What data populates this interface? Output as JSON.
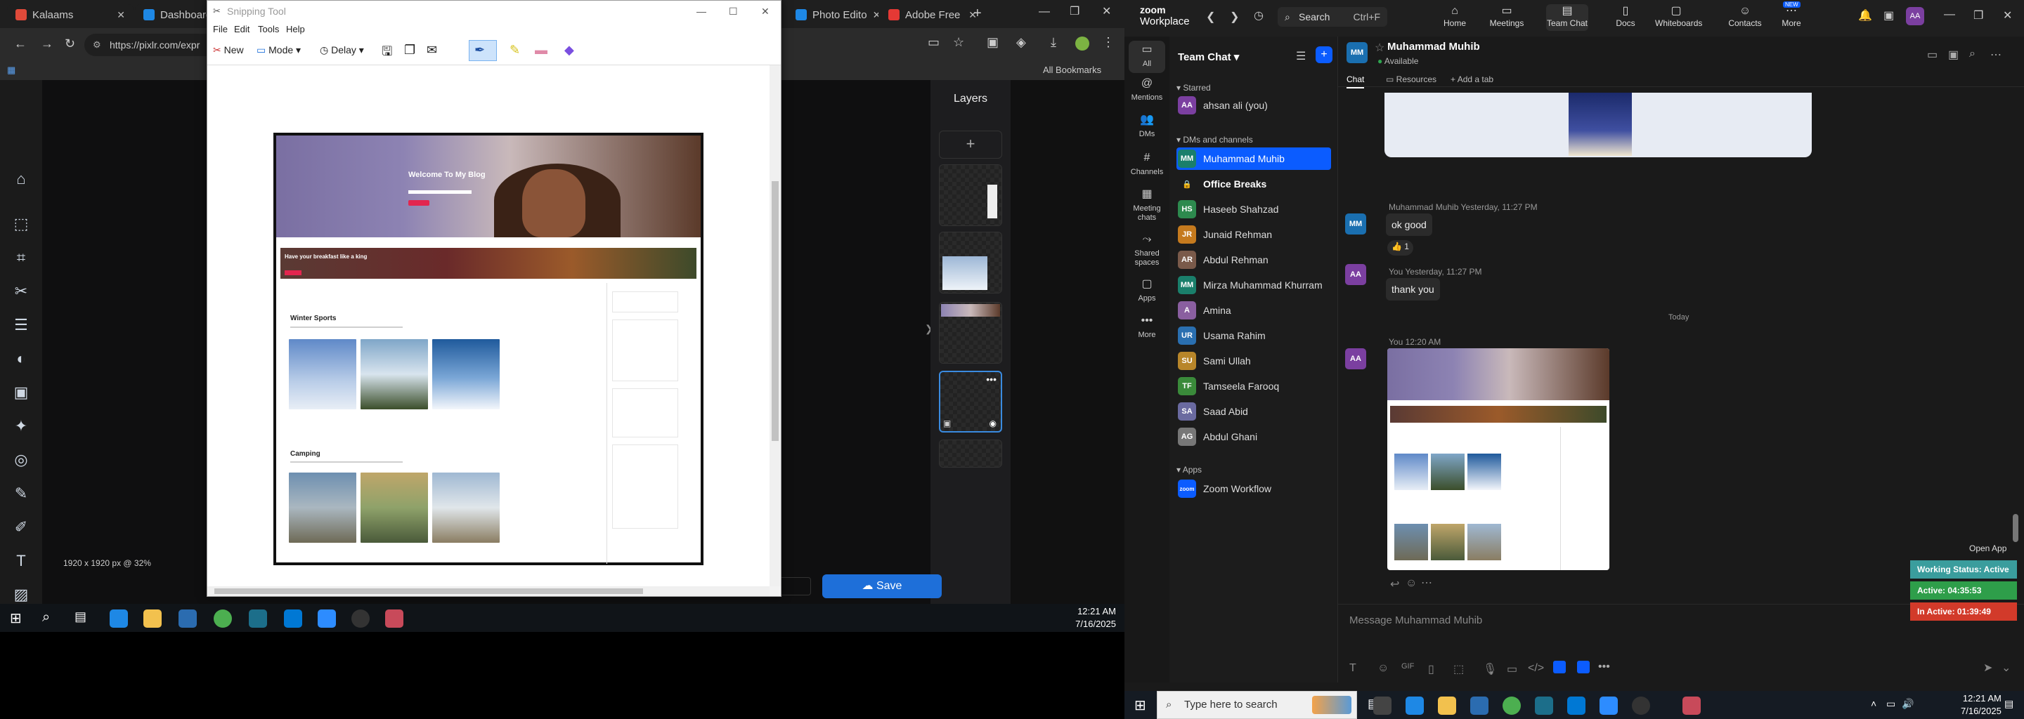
{
  "left_screen": {
    "browser_tabs": [
      {
        "title": "Kalaams",
        "color": "#e04a3a"
      },
      {
        "title": "Dashboard",
        "color": "#1e88e5"
      },
      {
        "title": "Photo Edito",
        "color": "#1e88e5"
      },
      {
        "title": "Adobe Free",
        "color": "#e53935"
      }
    ],
    "url": "https://pixlr.com/expr",
    "bookmarks_label": "All Bookmarks",
    "pixlr": {
      "layers_title": "Layers",
      "zoom_info": "1920 x 1920 px @ 32%",
      "save_label": "Save"
    },
    "snipping_tool": {
      "title": "Snipping Tool",
      "menu": [
        "File",
        "Edit",
        "Tools",
        "Help"
      ],
      "toolbar": {
        "new": "New",
        "mode": "Mode",
        "delay": "Delay"
      }
    },
    "blog": {
      "hero_title": "Welcome To My Blog",
      "breakfast_title": "Have your breakfast like a king",
      "section1": "Winter Sports",
      "section2": "Camping"
    },
    "clock": {
      "time": "12:21 AM",
      "date": "7/16/2025"
    }
  },
  "zoom": {
    "brand": "zoom",
    "brand_sub": "Workplace",
    "search_label": "Search",
    "search_shortcut": "Ctrl+F",
    "nav": [
      {
        "label": "Home",
        "icon": "home-icon"
      },
      {
        "label": "Meetings",
        "icon": "camera-icon"
      },
      {
        "label": "Team Chat",
        "icon": "chat-icon"
      },
      {
        "label": "Docs",
        "icon": "doc-icon"
      },
      {
        "label": "Whiteboards",
        "icon": "whiteboard-icon"
      },
      {
        "label": "Contacts",
        "icon": "contacts-icon"
      },
      {
        "label": "More",
        "icon": "more-icon",
        "badge": "NEW"
      }
    ],
    "rail": [
      {
        "label": "All"
      },
      {
        "label": "Mentions"
      },
      {
        "label": "DMs"
      },
      {
        "label": "Channels"
      },
      {
        "label": "Meeting chats"
      },
      {
        "label": "Shared spaces"
      },
      {
        "label": "Apps"
      },
      {
        "label": "More"
      }
    ],
    "list_title": "Team Chat",
    "starred_label": "Starred",
    "starred": [
      {
        "name": "ahsan ali (you)",
        "initials": "AA",
        "color": "#7b3fa0"
      }
    ],
    "dms_label": "DMs and channels",
    "dms": [
      {
        "name": "Muhammad Muhib",
        "initials": "MM",
        "color": "#1a7f6b"
      },
      {
        "name": "Office Breaks",
        "initials": "",
        "color": "#666"
      },
      {
        "name": "Haseeb Shahzad",
        "initials": "HS",
        "color": "#2d8a4e"
      },
      {
        "name": "Junaid Rehman",
        "initials": "JR",
        "color": "#c57a1e"
      },
      {
        "name": "Abdul Rehman",
        "initials": "AR",
        "color": "#7a5a4a"
      },
      {
        "name": "Mirza Muhammad Khurram",
        "initials": "MM",
        "color": "#1a7f6b"
      },
      {
        "name": "Amina",
        "initials": "A",
        "color": "#8a5fa0"
      },
      {
        "name": "Usama Rahim",
        "initials": "UR",
        "color": "#2a6fb0"
      },
      {
        "name": "Sami Ullah",
        "initials": "SU",
        "color": "#b8862a"
      },
      {
        "name": "Tamseela Farooq",
        "initials": "TF",
        "color": "#3a8a3a"
      },
      {
        "name": "Saad Abid",
        "initials": "SA",
        "color": "#6a6aa0"
      },
      {
        "name": "Abdul Ghani",
        "initials": "AG",
        "color": "#777"
      }
    ],
    "apps_label": "Apps",
    "apps": [
      {
        "name": "Zoom Workflow",
        "initials": "zoom",
        "color": "#0b5cff"
      }
    ],
    "chat": {
      "contact_name": "Muhammad Muhib",
      "contact_initials": "MM",
      "status": "Available",
      "tabs": [
        "Chat",
        "Resources",
        "Add a tab"
      ],
      "messages": [
        {
          "author": "Muhammad Muhib",
          "time": "Yesterday, 11:27 PM",
          "text": "ok good",
          "reaction": "👍 1"
        },
        {
          "author": "You",
          "time": "Yesterday, 11:27 PM",
          "text": "thank you"
        },
        {
          "author": "You",
          "time": "12:20 AM",
          "text": ""
        }
      ],
      "day_divider": "Today",
      "compose_placeholder": "Message Muhammad Muhib"
    },
    "status_widget": {
      "open_app": "Open App",
      "working": "Working Status: Active",
      "active": "Active: 04:35:53",
      "inactive": "In Active: 01:39:49",
      "colors": {
        "working": "#3a9d9d",
        "active": "#2e9e4a",
        "inactive": "#d23a2a"
      }
    },
    "taskbar": {
      "search_placeholder": "Type here to search",
      "time": "12:21 AM",
      "date": "7/16/2025"
    }
  }
}
